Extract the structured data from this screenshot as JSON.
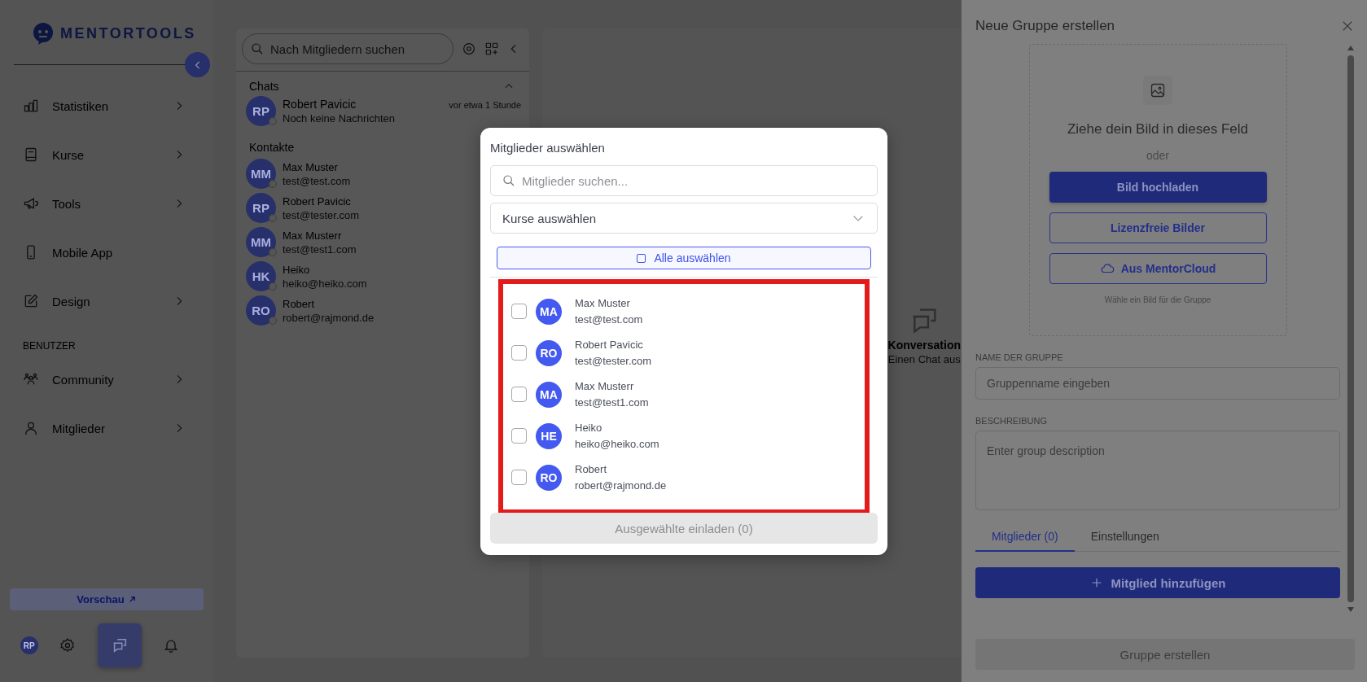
{
  "sidebar": {
    "logo": "MENTORTOOLS",
    "groups": [
      {
        "items": [
          {
            "label": "Statistiken",
            "expandable": true
          },
          {
            "label": "Kurse",
            "expandable": true
          },
          {
            "label": "Tools",
            "expandable": true
          },
          {
            "label": "Mobile App",
            "expandable": false
          },
          {
            "label": "Design",
            "expandable": true
          }
        ]
      },
      {
        "heading": "BENUTZER",
        "items": [
          {
            "label": "Community",
            "expandable": true
          },
          {
            "label": "Mitglieder",
            "expandable": true
          }
        ]
      }
    ],
    "preview_button": "Vorschau",
    "bottom_bar": {
      "avatar": "RP",
      "items": [
        {
          "selected": false
        },
        {
          "selected": true
        },
        {
          "selected": false
        }
      ]
    }
  },
  "chat_panel": {
    "search_placeholder": "Nach Mitgliedern suchen",
    "chats_heading": "Chats",
    "chats": [
      {
        "initials": "RP",
        "name": "Robert Pavicic",
        "subtitle": "Noch keine Nachrichten",
        "time": "vor etwa 1 Stunde"
      }
    ],
    "contacts_heading": "Kontakte",
    "contacts": [
      {
        "initials": "MM",
        "name": "Max Muster",
        "subtitle": "test@test.com"
      },
      {
        "initials": "RP",
        "name": "Robert Pavicic",
        "subtitle": "test@tester.com"
      },
      {
        "initials": "MM",
        "name": "Max Musterr",
        "subtitle": "test@test1.com"
      },
      {
        "initials": "HK",
        "name": "Heiko",
        "subtitle": "heiko@heiko.com"
      },
      {
        "initials": "RO",
        "name": "Robert",
        "subtitle": "robert@rajmond.de"
      }
    ]
  },
  "main": {
    "empty_title": "Konversation",
    "empty_text": "Einen Chat aus"
  },
  "modal": {
    "title": "Mitglieder auswählen",
    "search_placeholder": "Mitglieder suchen...",
    "course_select": "Kurse auswählen",
    "select_all": {
      "label": "Alle auswählen",
      "checked": false
    },
    "members": [
      {
        "initials": "MA",
        "name": "Max Muster",
        "email": "test@test.com",
        "checked": false
      },
      {
        "initials": "RO",
        "name": "Robert Pavicic",
        "email": "test@tester.com",
        "checked": false
      },
      {
        "initials": "MA",
        "name": "Max Musterr",
        "email": "test@test1.com",
        "checked": false
      },
      {
        "initials": "HE",
        "name": "Heiko",
        "email": "heiko@heiko.com",
        "checked": false
      },
      {
        "initials": "RO",
        "name": "Robert",
        "email": "robert@rajmond.de",
        "checked": false
      }
    ],
    "invite_button": {
      "label": "Ausgewählte einladen (0)",
      "disabled": true
    }
  },
  "panel": {
    "title": "Neue Gruppe erstellen",
    "upload": {
      "drop_text": "Ziehe dein Bild in dieses Feld",
      "or_text": "oder",
      "upload_button": "Bild hochladen",
      "free_images_button": "Lizenzfreie Bilder",
      "cloud_button": "Aus MentorCloud",
      "hint": "Wähle ein Bild für die Gruppe"
    },
    "name_label": "NAME DER GRUPPE",
    "name_placeholder": "Gruppenname eingeben",
    "description_label": "BESCHREIBUNG",
    "description_placeholder": "Enter group description",
    "tabs": [
      {
        "label": "Mitglieder (0)",
        "selected": true
      },
      {
        "label": "Einstellungen",
        "selected": false
      }
    ],
    "add_member_button": "Mitglied hinzufügen",
    "create_button": {
      "label": "Gruppe erstellen",
      "disabled": true
    }
  }
}
